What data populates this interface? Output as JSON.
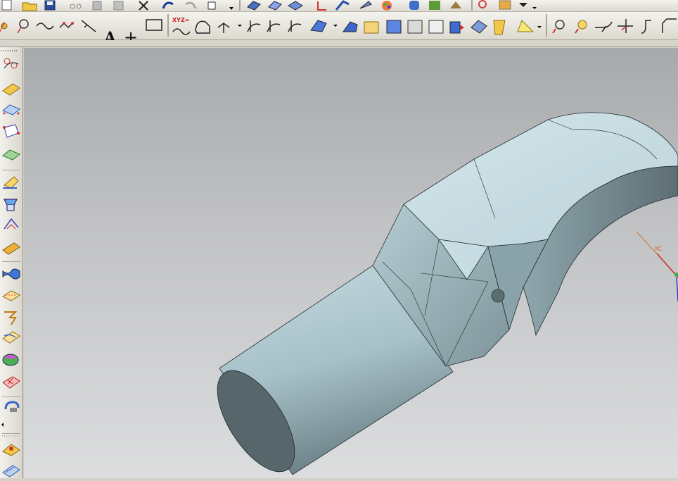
{
  "toolbar_row1": {
    "tools": [
      "new-icon",
      "open-icon",
      "save-icon",
      "cut-icon",
      "copy-icon",
      "paste-icon",
      "delete-icon",
      "undo-icon",
      "redo-icon",
      "select-filter-icon",
      "shaded-view-icon",
      "wireframe-view-icon",
      "layer-icon",
      "wcs-icon",
      "fan-icon",
      "sketch-icon",
      "color-palette-icon",
      "cylinder-icon",
      "block-icon",
      "feature-icon",
      "inspect-icon",
      "ruler-icon",
      "dropdown-icon"
    ]
  },
  "toolbar_row2": {
    "text_tool_glyph": "A",
    "xyz_label": "XYZ=",
    "point_glyph": "+"
  },
  "viewport": {
    "axis_label": "XC"
  },
  "colors": {
    "part_light": "#c9dde3",
    "part_mid": "#9fb9c1",
    "part_dark": "#5d6e73",
    "background_top": "#a7a9ab",
    "background_bottom": "#dcddde"
  }
}
